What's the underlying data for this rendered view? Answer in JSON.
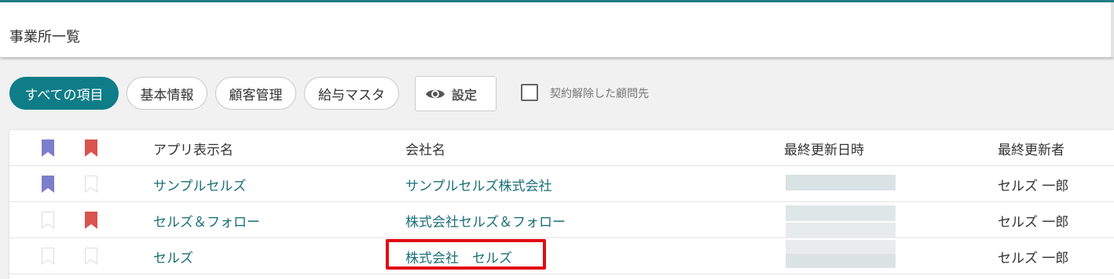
{
  "header": {
    "title": "事業所一覧"
  },
  "filters": {
    "all": "すべての項目",
    "basic": "基本情報",
    "customer": "顧客管理",
    "payroll": "給与マスタ"
  },
  "settings": {
    "label": "設定",
    "icon": "eye-icon"
  },
  "terminated": {
    "label": "契約解除した顧問先",
    "checked": false
  },
  "colors": {
    "accent": "#0e7d88",
    "bookmark_blue": "#7b7fc9",
    "bookmark_red": "#d9534f",
    "highlight": "#e00d12"
  },
  "table": {
    "columns": {
      "app_name": "アプリ表示名",
      "company": "会社名",
      "updated_at": "最終更新日時",
      "updated_by": "最終更新者"
    },
    "rows": [
      {
        "app_name": "サンプルセルズ",
        "company": "サンプルセルズ株式会社",
        "updated_by": "セルズ 一郎",
        "bookmark_blue": true,
        "bookmark_red": false
      },
      {
        "app_name": "セルズ＆フォロー",
        "company": "株式会社セルズ＆フォロー",
        "updated_by": "セルズ 一郎",
        "bookmark_blue": false,
        "bookmark_red": true
      },
      {
        "app_name": "セルズ",
        "company": "株式会社　セルズ",
        "updated_by": "セルズ 一郎",
        "bookmark_blue": false,
        "bookmark_red": false
      }
    ]
  }
}
